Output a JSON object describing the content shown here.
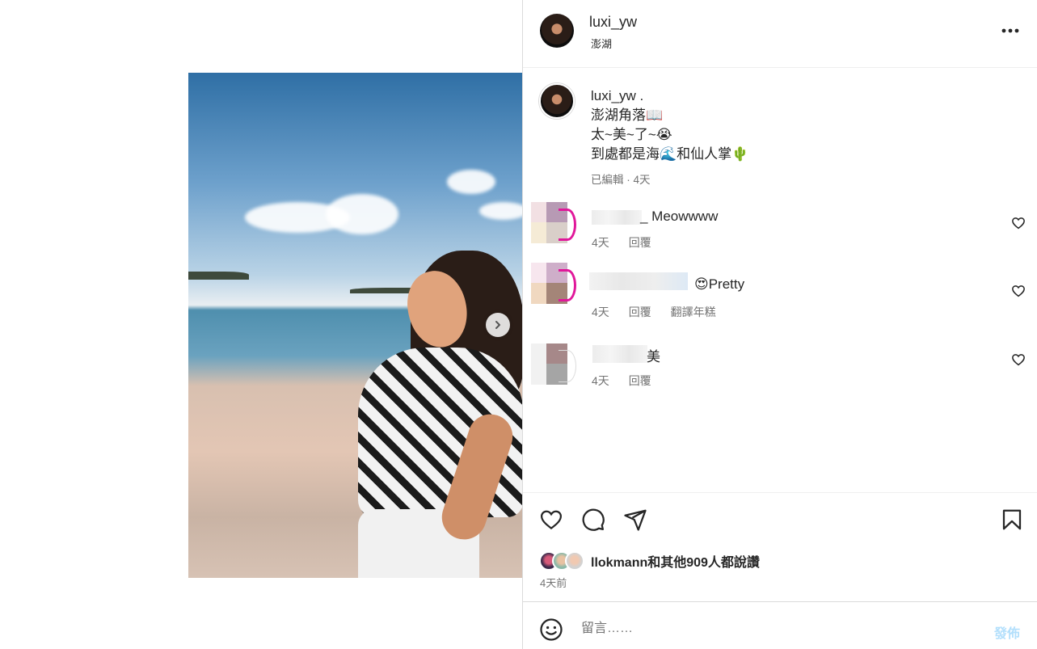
{
  "post": {
    "username": "luxi_yw",
    "location": "澎湖"
  },
  "caption": {
    "username": "luxi_yw .",
    "lines": [
      "澎湖角落📖",
      "太~美~了~😭",
      "到處都是海🌊和仙人掌🌵"
    ],
    "edited_label": "已編輯",
    "separator": "·",
    "time": "4天"
  },
  "comments": [
    {
      "text": "_ Meowwww",
      "time": "4天",
      "reply": "回覆",
      "colors": [
        "#f2e0e3",
        "#b79ab4",
        "#f5ebd6",
        "#d9cfc9"
      ]
    },
    {
      "text": "😍Pretty",
      "time": "4天",
      "reply": "回覆",
      "translate": "翻譯年糕",
      "colors": [
        "#f7e6ee",
        "#ceaec9",
        "#f0d8c0",
        "#a48578"
      ]
    },
    {
      "text": "美",
      "time": "4天",
      "reply": "回覆",
      "colors": [
        "#f1f1f1",
        "#a68889",
        "#f1f1f1",
        "#a5a5a5"
      ]
    }
  ],
  "actions": {
    "likes_text": "llokmann和其他909人都說讚",
    "time_ago": "4天前"
  },
  "comment_box": {
    "placeholder": "留言……",
    "post_label": "發佈"
  },
  "colors": {
    "accent_ring": "#e0179a",
    "post_button_disabled": "#b2dffc",
    "secondary_text": "#737373"
  },
  "icons": [
    "chevron-right-icon",
    "more-icon",
    "heart-icon",
    "comment-icon",
    "share-icon",
    "bookmark-icon",
    "emoji-icon"
  ]
}
